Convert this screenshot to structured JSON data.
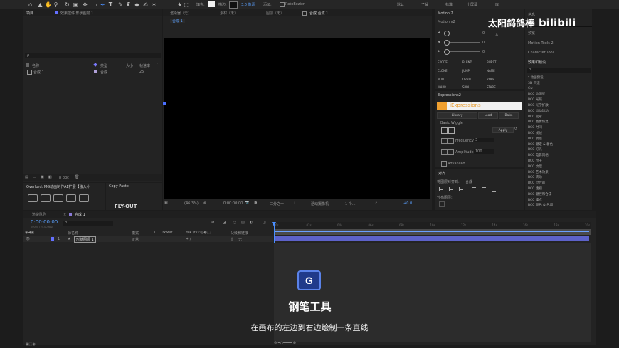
{
  "toolbar": {
    "fill_label": "填充:",
    "stroke_label": "描边:",
    "stroke_width": "3.0 像素",
    "add_label": "添加:",
    "bezier_label": "RotoBezier",
    "workspaces": [
      "默认",
      "学习",
      "标准",
      "小屏幕",
      "库"
    ],
    "learn_label": "了解"
  },
  "project_panel": {
    "tab_label": "项目",
    "effect_controls_tab": "效果控件 形状图层 1",
    "search_placeholder": "ρ",
    "columns": [
      "名称",
      "类型",
      "大小",
      "帧速率"
    ],
    "items": [
      {
        "name": "合成 1",
        "type": "合成",
        "fps": "25"
      }
    ],
    "bpc": "8 bpc"
  },
  "overlord_panel": {
    "tab_label": "Overlord: MG动画制作AE扩展【独入小",
    "copy_paste_tab": "Copy Paste",
    "fly_out_label": "FLY-OUT"
  },
  "comp_panel": {
    "tabs": [
      "渲染器（无）",
      "素材（无）",
      "图层（无）",
      "合成 合成 1"
    ],
    "breadcrumb": "合成 1",
    "zoom": "(46.3%)",
    "timecode": "0:00:00:00",
    "resolution": "二分之一",
    "camera": "活动摄像机",
    "views": "1 个...",
    "exposure": "+0.0"
  },
  "motion_panel": {
    "title": "Motion 2",
    "version": "Motion v2",
    "slider_values": [
      "0",
      "0",
      "0"
    ],
    "buttons": [
      "EXCITE",
      "BLEND",
      "BURST",
      "CLONE",
      "JUMP",
      "NAME",
      "NULL",
      "ORBIT",
      "ROPE",
      "WARP",
      "SPIN",
      "STARE"
    ]
  },
  "expressions_panel": {
    "tab": "Expressions2",
    "logo_text": "iExpressions",
    "buttons": [
      "Library",
      "Load",
      "Bake"
    ],
    "section": "Basic Wiggle",
    "apply": "Apply",
    "frequency_label": "Frequency",
    "frequency_value": "3",
    "amplitude_label": "Amplitude",
    "amplitude_value": "100",
    "advanced": "Advanced"
  },
  "align_panel": {
    "title": "对齐",
    "align_to_label": "将图层对齐到:",
    "align_to_value": "合成",
    "distribute_label": "分布图层:"
  },
  "right_panel": {
    "sections": [
      "信息",
      "音频",
      "预览",
      "Motion Tools 2",
      "Character Tool",
      "效果和预设"
    ],
    "search_placeholder": "ρ",
    "effects": [
      "* 动画预设",
      "3D 声道",
      "Cw",
      "BCC 动明星",
      "BCC 光照",
      "BCC 光学扩散",
      "BCC 运动运动",
      "BCC 变形",
      "BCC 图像恢复",
      "BCC 时间",
      "BCC 帧帧",
      "BCC 模版",
      "BCC 键定 & 着色",
      "BCC 灯光",
      "BCC 电影风格",
      "BCC 粒子",
      "BCC 纹理",
      "BCC 艺术效果",
      "BCC 转场",
      "BCC 过时的",
      "BCC 透视",
      "BCC 键控和合成",
      "BCC 噪点",
      "BCC 颜色 & 色调"
    ]
  },
  "watermark": {
    "channel": "太阳鸽鸽棒",
    "site": "bilibili"
  },
  "timeline": {
    "tabs": [
      "渲染队列",
      "合成 1"
    ],
    "timecode": "0:00:00:00",
    "fps_hint": "00000 (25.00 fps)",
    "columns": [
      "源名称",
      "模式",
      "T",
      "TrkMat",
      "父级和链接"
    ],
    "layer": {
      "index": "1",
      "name": "形状图层 1",
      "mode": "正常",
      "parent": "无"
    },
    "ruler": [
      "0s",
      "02s",
      "04s",
      "06s",
      "08s",
      "10s",
      "12s",
      "14s",
      "16s",
      "18s",
      "20s"
    ]
  },
  "overlay": {
    "key": "G",
    "tool_name": "钢笔工具",
    "subtitle": "在画布的左边到右边绘制一条直线"
  }
}
